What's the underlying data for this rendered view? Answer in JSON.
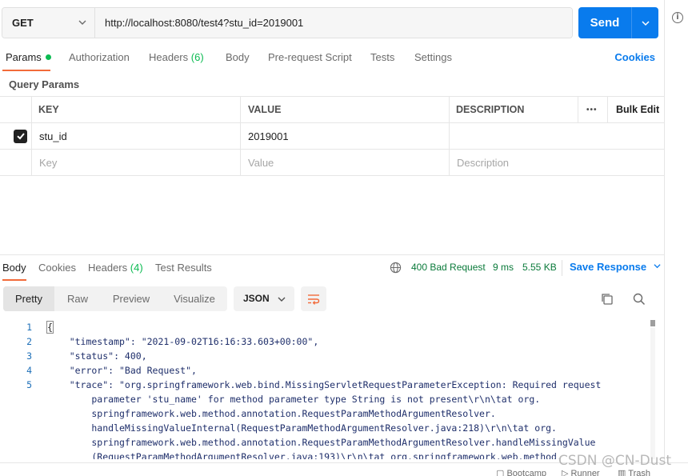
{
  "request": {
    "method": "GET",
    "url": "http://localhost:8080/test4?stu_id=2019001",
    "send_label": "Send"
  },
  "request_tabs": {
    "params": "Params",
    "authorization": "Authorization",
    "headers": "Headers",
    "headers_count": "(6)",
    "body": "Body",
    "pre_request_script": "Pre-request Script",
    "tests": "Tests",
    "settings": "Settings",
    "cookies": "Cookies"
  },
  "query_params": {
    "title": "Query Params",
    "columns": {
      "key": "KEY",
      "value": "VALUE",
      "description": "DESCRIPTION",
      "more": "•••",
      "bulk_edit": "Bulk Edit"
    },
    "rows": [
      {
        "checked": true,
        "key": "stu_id",
        "value": "2019001",
        "description": ""
      }
    ],
    "placeholders": {
      "key": "Key",
      "value": "Value",
      "description": "Description"
    }
  },
  "response_tabs": {
    "body": "Body",
    "cookies": "Cookies",
    "headers": "Headers",
    "headers_count": "(4)",
    "test_results": "Test Results"
  },
  "response_meta": {
    "status": "400 Bad Request",
    "time": "9 ms",
    "size": "5.55 KB",
    "save_response": "Save Response"
  },
  "view_modes": {
    "pretty": "Pretty",
    "raw": "Raw",
    "preview": "Preview",
    "visualize": "Visualize",
    "format": "JSON"
  },
  "code": {
    "line_numbers": [
      "1",
      "2",
      "3",
      "4",
      "5"
    ],
    "lines": [
      "{",
      "    \"timestamp\": \"2021-09-02T16:16:33.603+00:00\",",
      "    \"status\": 400,",
      "    \"error\": \"Bad Request\",",
      "    \"trace\": \"org.springframework.web.bind.MissingServletRequestParameterException: Required request",
      "        parameter 'stu_name' for method parameter type String is not present\\r\\n\\tat org.",
      "        springframework.web.method.annotation.RequestParamMethodArgumentResolver.",
      "        handleMissingValueInternal(RequestParamMethodArgumentResolver.java:218)\\r\\n\\tat org.",
      "        springframework.web.method.annotation.RequestParamMethodArgumentResolver.handleMissingValue",
      "        (RequestParamMethodArgumentResolver.java:193)\\r\\n\\tat org.springframework.web.method."
    ]
  },
  "footer": {
    "bootcamp": "Bootcamp",
    "runner": "Runner",
    "trash": "Trash"
  },
  "watermark": "CSDN @CN-Dust",
  "colors": {
    "accent_blue": "#097bed",
    "active_orange": "#f26b3a",
    "ok_green": "#0cbb52"
  }
}
